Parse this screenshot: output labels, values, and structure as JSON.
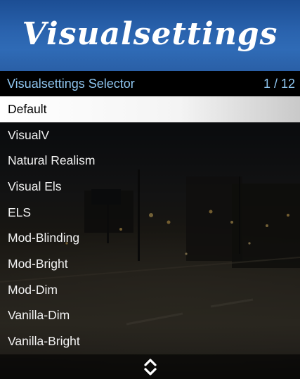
{
  "header": {
    "title": "Visualsettings"
  },
  "menu": {
    "subtitle": "Visualsettings Selector",
    "counter": "1 / 12",
    "selected_index": 0,
    "items": [
      {
        "label": "Default"
      },
      {
        "label": "VisualV"
      },
      {
        "label": "Natural Realism"
      },
      {
        "label": "Visual Els"
      },
      {
        "label": "ELS"
      },
      {
        "label": "Mod-Blinding"
      },
      {
        "label": "Mod-Bright"
      },
      {
        "label": "Mod-Dim"
      },
      {
        "label": "Vanilla-Dim"
      },
      {
        "label": "Vanilla-Bright"
      }
    ]
  },
  "footer": {
    "icon": "scroll-up-down-icon"
  },
  "colors": {
    "header_blue": "#2a63ae",
    "subtitle_text": "#8fc6f0",
    "selected_bg": "#ffffff",
    "selected_text": "#000000",
    "item_text": "#f2f2f2"
  }
}
